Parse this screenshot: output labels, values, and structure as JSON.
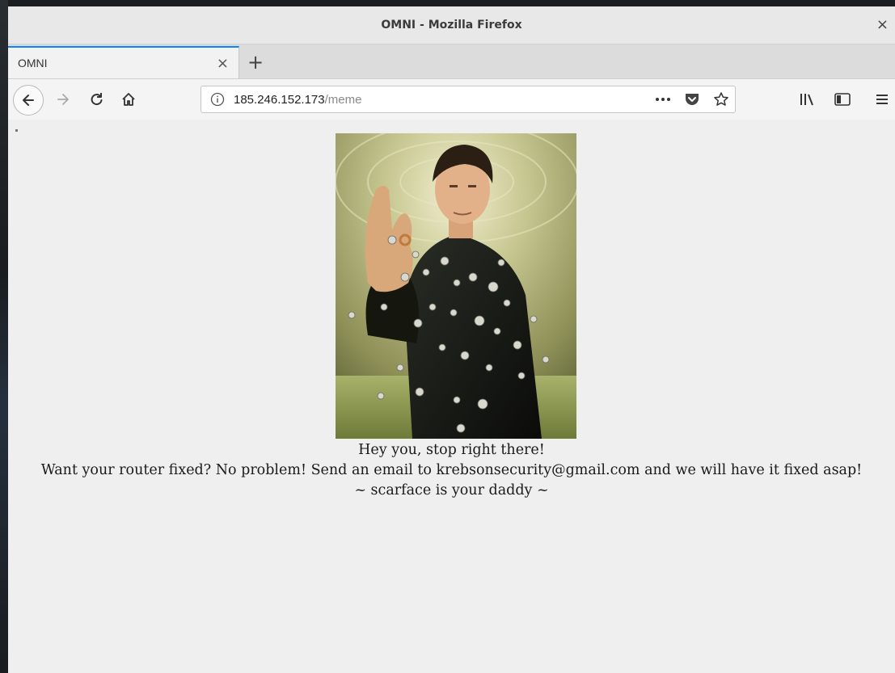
{
  "window": {
    "title": "OMNI - Mozilla Firefox",
    "close_label": "×"
  },
  "tab": {
    "label": "OMNI",
    "close_label": "×",
    "new_tab_label": "+"
  },
  "url": {
    "host": "185.246.152.173",
    "path": "/meme"
  },
  "icons": {
    "back": "back-arrow-icon",
    "forward": "forward-arrow-icon",
    "reload": "reload-icon",
    "home": "home-icon",
    "info": "info-icon",
    "page_actions": "more-icon",
    "pocket": "pocket-icon",
    "bookmark": "star-icon",
    "library": "library-icon",
    "sidebar": "sidebar-icon",
    "menu": "hamburger-menu-icon"
  },
  "page": {
    "line1": "Hey you, stop right there!",
    "line2": "Want your router fixed? No problem! Send an email to krebsonsecurity@gmail.com and we will have it fixed asap!",
    "line3": "~ scarface is your daddy ~"
  },
  "colors": {
    "tab_accent": "#0a84ff",
    "page_bg": "#efefef"
  }
}
